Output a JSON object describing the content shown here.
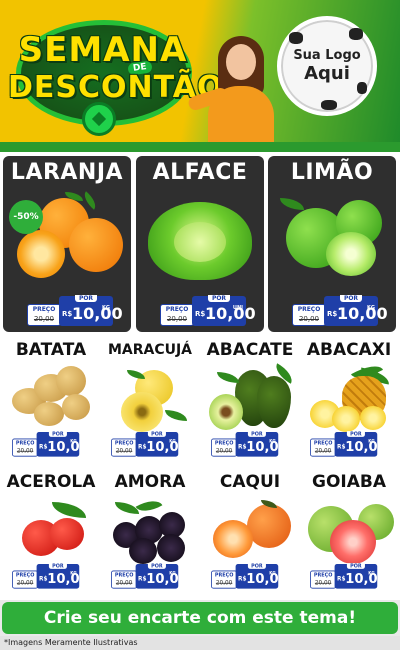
{
  "header": {
    "title_line1": "SEMANA",
    "title_connector": "DE",
    "title_line2": "DESCONTÃO",
    "brand_line1": "Sua Logo",
    "brand_line2": "Aqui"
  },
  "price_labels": {
    "old": "PREÇO",
    "new": "POR",
    "currency": "R$",
    "unit": "KG"
  },
  "featured": [
    {
      "name": "LARANJA",
      "badge": "-50%",
      "old_price": "20,00",
      "price": "10,00"
    },
    {
      "name": "ALFACE",
      "old_price": "20,00",
      "price": "10,00",
      "unit": "UNI"
    },
    {
      "name": "LIMÃO",
      "old_price": "20,00",
      "price": "10,00"
    }
  ],
  "products": [
    {
      "name": "BATATA",
      "old_price": "20,00",
      "price": "10,00"
    },
    {
      "name": "MARACUJÁ",
      "old_price": "20,00",
      "price": "10,00"
    },
    {
      "name": "ABACATE",
      "old_price": "20,00",
      "price": "10,00"
    },
    {
      "name": "ABACAXI",
      "old_price": "20,00",
      "price": "10,00"
    },
    {
      "name": "ACEROLA",
      "old_price": "20,00",
      "price": "10,00"
    },
    {
      "name": "AMORA",
      "old_price": "20,00",
      "price": "10,00"
    },
    {
      "name": "CAQUI",
      "old_price": "20,00",
      "price": "10,00"
    },
    {
      "name": "GOIABA",
      "old_price": "20,00",
      "price": "10,00"
    }
  ],
  "footer": {
    "cta": "Crie seu encarte com este tema!",
    "disclaimer": "*Imagens Meramente Ilustrativas"
  },
  "colors": {
    "accent_green": "#2fae3a",
    "price_blue": "#1f3fa8",
    "header_yellow": "#f2c300"
  }
}
